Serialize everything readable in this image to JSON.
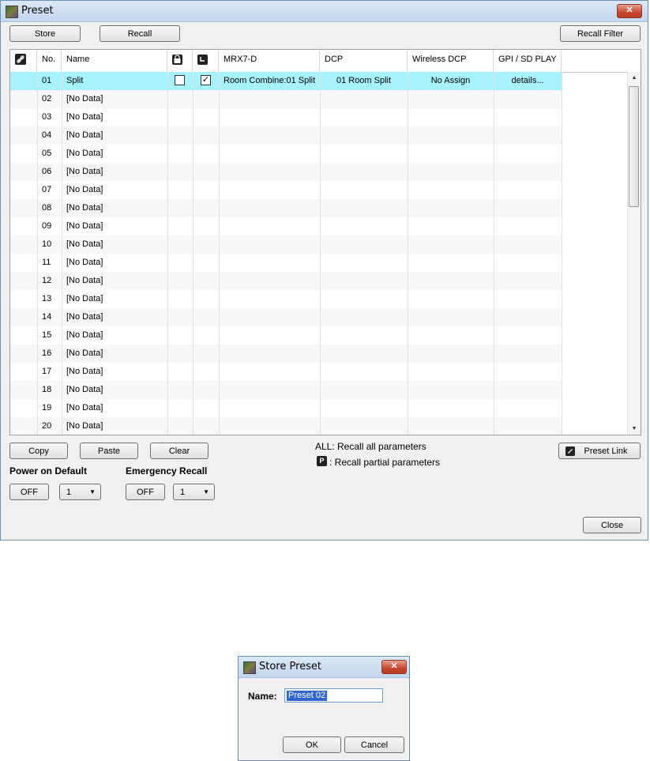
{
  "window": {
    "title": "Preset",
    "close_label": "✕"
  },
  "toolbar": {
    "store": "Store",
    "recall": "Recall",
    "recall_filter": "Recall Filter"
  },
  "grid": {
    "headers": {
      "link": "link-icon",
      "no": "No.",
      "name": "Name",
      "lock": "protect-icon",
      "clock": "schedule-icon",
      "mrx": "MRX7-D",
      "dcp": "DCP",
      "wdcp": "Wireless DCP",
      "gpi": "GPI / SD PLAY"
    },
    "rows": [
      {
        "no": "01",
        "name": "Split",
        "lock": false,
        "sched": true,
        "mrx": "Room Combine:01 Split",
        "dcp": "01 Room Split",
        "wdcp": "No Assign",
        "gpi": "details..."
      },
      {
        "no": "02",
        "name": "[No Data]"
      },
      {
        "no": "03",
        "name": "[No Data]"
      },
      {
        "no": "04",
        "name": "[No Data]"
      },
      {
        "no": "05",
        "name": "[No Data]"
      },
      {
        "no": "06",
        "name": "[No Data]"
      },
      {
        "no": "07",
        "name": "[No Data]"
      },
      {
        "no": "08",
        "name": "[No Data]"
      },
      {
        "no": "09",
        "name": "[No Data]"
      },
      {
        "no": "10",
        "name": "[No Data]"
      },
      {
        "no": "11",
        "name": "[No Data]"
      },
      {
        "no": "12",
        "name": "[No Data]"
      },
      {
        "no": "13",
        "name": "[No Data]"
      },
      {
        "no": "14",
        "name": "[No Data]"
      },
      {
        "no": "15",
        "name": "[No Data]"
      },
      {
        "no": "16",
        "name": "[No Data]"
      },
      {
        "no": "17",
        "name": "[No Data]"
      },
      {
        "no": "18",
        "name": "[No Data]"
      },
      {
        "no": "19",
        "name": "[No Data]"
      },
      {
        "no": "20",
        "name": "[No Data]"
      }
    ]
  },
  "actions": {
    "copy": "Copy",
    "paste": "Paste",
    "clear": "Clear",
    "preset_link": "Preset Link"
  },
  "legend": {
    "all": "ALL: Recall all parameters",
    "partial_badge": "P",
    "partial": ": Recall partial parameters"
  },
  "power_on_default": {
    "label": "Power on Default",
    "state": "OFF",
    "value": "1"
  },
  "emergency_recall": {
    "label": "Emergency Recall",
    "state": "OFF",
    "value": "1"
  },
  "footer": {
    "close": "Close"
  },
  "dialog": {
    "title": "Store Preset",
    "name_label": "Name:",
    "name_value": "Preset 02",
    "ok": "OK",
    "cancel": "Cancel",
    "close_label": "✕"
  },
  "colors": {
    "selected_row": "#a6f3ff",
    "title_gradient_top": "#dbe8f6",
    "close_red": "#c9462c"
  }
}
